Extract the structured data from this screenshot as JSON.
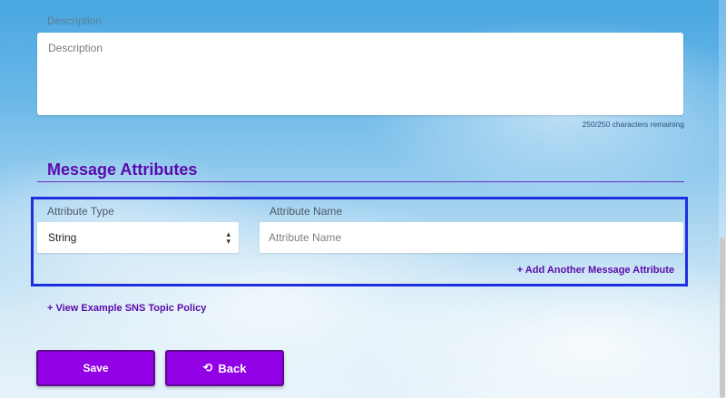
{
  "description": {
    "label": "Description",
    "placeholder": "Description",
    "char_remaining": "250/250 characters remaining"
  },
  "message_attributes": {
    "title": "Message Attributes",
    "attribute_type_label": "Attribute Type",
    "attribute_type_value": "String",
    "attribute_name_label": "Attribute Name",
    "attribute_name_placeholder": "Attribute Name",
    "add_link": "+ Add Another Message Attribute"
  },
  "policy_link": "+ View Example SNS Topic Policy",
  "buttons": {
    "save": "Save",
    "back": "Back"
  },
  "icons": {
    "select_arrow": "updown-chevron-icon",
    "back": "undo-arrow-icon"
  },
  "colors": {
    "accent": "#9200e6",
    "heading": "#5a0bab",
    "highlight_border": "#1f2fe0"
  }
}
